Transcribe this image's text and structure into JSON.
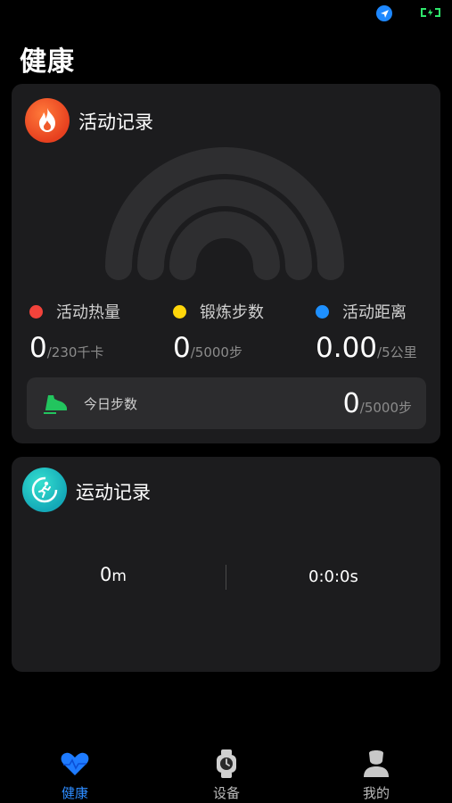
{
  "page": {
    "title": "健康"
  },
  "colors": {
    "calorie": "#f2433b",
    "steps": "#ffd60a",
    "distance": "#1e90ff",
    "accent": "#2d8cff"
  },
  "activity": {
    "title": "活动记录",
    "icon": "flame-icon",
    "metrics": [
      {
        "label": "活动热量",
        "value": "0",
        "goal": "/230千卡"
      },
      {
        "label": "锻炼步数",
        "value": "0",
        "goal": "/5000步"
      },
      {
        "label": "活动距离",
        "value": "0.00",
        "goal": "/5公里"
      }
    ],
    "today": {
      "label": "今日步数",
      "value": "0",
      "goal": "/5000步",
      "icon": "shoe-icon"
    }
  },
  "sport": {
    "title": "运动记录",
    "icon": "running-icon",
    "distance_value": "0",
    "distance_unit": "m",
    "duration": "0:0:0s"
  },
  "tabs": [
    {
      "label": "健康",
      "icon": "heart-icon",
      "active": true
    },
    {
      "label": "设备",
      "icon": "watch-icon",
      "active": false
    },
    {
      "label": "我的",
      "icon": "person-icon",
      "active": false
    }
  ]
}
